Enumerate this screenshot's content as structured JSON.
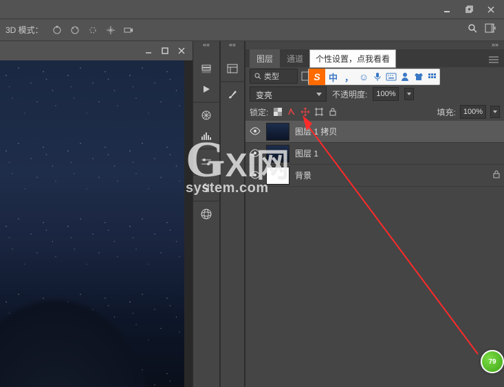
{
  "window": {
    "minimize": "minimize",
    "restore": "restore",
    "close": "close"
  },
  "options_bar": {
    "mode_label": "3D 模式："
  },
  "tooltip": {
    "text": "个性设置，点我看看"
  },
  "ime": {
    "logo": "S",
    "lang": "中",
    "punct": "，"
  },
  "panel": {
    "tabs": {
      "layers": "图层",
      "channels": "通道"
    },
    "type_filter": "类型",
    "blend_mode": "变亮",
    "opacity_label": "不透明度:",
    "opacity_value": "100%",
    "lock_label": "锁定:",
    "fill_label": "填充:",
    "fill_value": "100%"
  },
  "layers": [
    {
      "name": "图层 1 拷贝",
      "visible": true,
      "selected": true,
      "locked": false
    },
    {
      "name": "图层 1",
      "visible": true,
      "selected": false,
      "locked": false
    },
    {
      "name": "背景",
      "visible": true,
      "selected": false,
      "locked": true
    }
  ],
  "watermark": {
    "brand": "XI网",
    "domain": "system.com"
  },
  "badge": {
    "value": "79"
  }
}
